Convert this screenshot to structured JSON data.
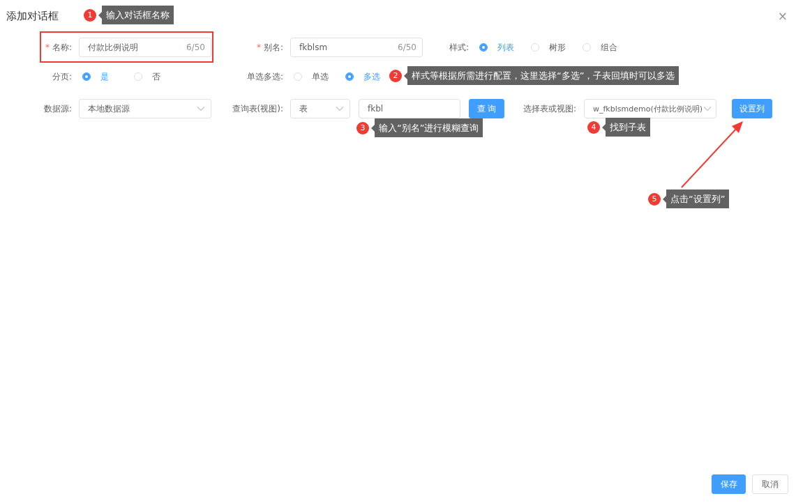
{
  "dialog": {
    "title": "添加对话框",
    "close": "×"
  },
  "rows": [
    {
      "fields": [
        {
          "required_mark": "*",
          "label": "名称:",
          "highlighted": true,
          "controls": [
            {
              "kind": "input",
              "value": "付款比例说明",
              "counter": "6/50"
            }
          ]
        },
        {
          "required_mark": "*",
          "label": "别名:",
          "controls": [
            {
              "kind": "input",
              "value": "fkblsm",
              "counter": "6/50"
            }
          ]
        },
        {
          "label": "样式:",
          "controls": [
            {
              "kind": "radios",
              "options": [
                {
                  "label": "列表",
                  "selected": true
                },
                {
                  "label": "树形",
                  "selected": false
                },
                {
                  "label": "组合",
                  "selected": false
                }
              ]
            }
          ]
        }
      ]
    },
    {
      "fields": [
        {
          "label": "分页:",
          "controls": [
            {
              "kind": "radios",
              "options": [
                {
                  "label": "是",
                  "selected": true
                },
                {
                  "label": "否",
                  "selected": false
                }
              ]
            }
          ]
        },
        {
          "label": "单选多选:",
          "controls": [
            {
              "kind": "radios",
              "options": [
                {
                  "label": "单选",
                  "selected": false
                },
                {
                  "label": "多选",
                  "selected": true
                }
              ]
            }
          ]
        }
      ]
    },
    {
      "fields": [
        {
          "label": "数据源:",
          "controls": [
            {
              "kind": "select",
              "value": "本地数据源"
            }
          ]
        },
        {
          "label": "查询表(视图):",
          "controls": [
            {
              "kind": "select",
              "value": "表"
            },
            {
              "kind": "input",
              "value": "fkbl"
            },
            {
              "kind": "button",
              "label": "查 询"
            }
          ]
        },
        {
          "label": "选择表或视图:",
          "controls": [
            {
              "kind": "select",
              "value": "w_fkblsmdemo(付款比例说明)"
            },
            {
              "kind": "button",
              "label": "设置列"
            }
          ]
        }
      ]
    }
  ],
  "annotations": [
    {
      "number": "1",
      "text": "输入对话框名称"
    },
    {
      "number": "2",
      "text": "样式等根据所需进行配置，这里选择“多选”，子表回填时可以多选"
    },
    {
      "number": "3",
      "text": "输入“别名”进行模糊查询"
    },
    {
      "number": "4",
      "text": "找到子表"
    },
    {
      "number": "5",
      "text": "点击“设置列”",
      "arrow": true
    }
  ],
  "footer": [
    {
      "kind": "primary",
      "label": "保存"
    },
    {
      "kind": "default",
      "label": "取消"
    }
  ]
}
